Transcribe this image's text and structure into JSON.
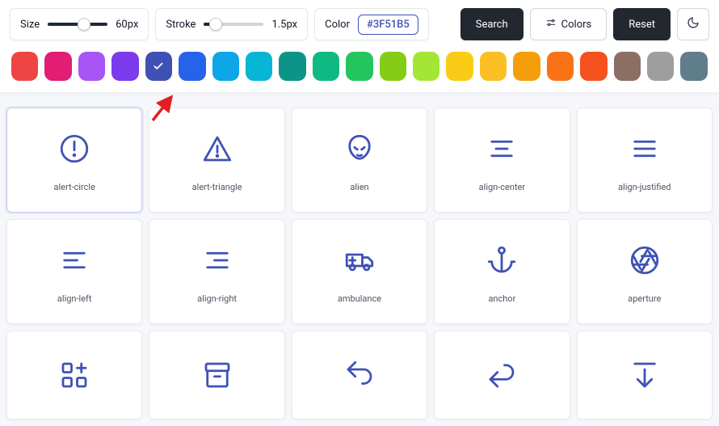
{
  "toolbar": {
    "size_label": "Size",
    "size_value": "60px",
    "stroke_label": "Stroke",
    "stroke_value": "1.5px",
    "color_label": "Color",
    "color_value": "#3F51B5",
    "search_label": "Search",
    "colors_label": "Colors",
    "reset_label": "Reset"
  },
  "palette": {
    "selected_index": 4,
    "colors": [
      "#ef4444",
      "#e11d74",
      "#a855f7",
      "#7c3aed",
      "#3F51B5",
      "#2563eb",
      "#0ea5e9",
      "#06b6d4",
      "#0d9488",
      "#10b981",
      "#22c55e",
      "#84cc16",
      "#a3e635",
      "#facc15",
      "#fbbf24",
      "#f59e0b",
      "#f97316",
      "#f4511e",
      "#8d6e63",
      "#9e9e9e",
      "#607d8b"
    ]
  },
  "icons": [
    {
      "name": "alert-circle",
      "selected": true
    },
    {
      "name": "alert-triangle"
    },
    {
      "name": "alien"
    },
    {
      "name": "align-center"
    },
    {
      "name": "align-justified"
    },
    {
      "name": "align-left"
    },
    {
      "name": "align-right"
    },
    {
      "name": "ambulance"
    },
    {
      "name": "anchor"
    },
    {
      "name": "aperture"
    }
  ],
  "icons_row3": [
    "apps",
    "archive",
    "arrow-back-up",
    "arrow-back",
    "arrow-bar-down"
  ]
}
